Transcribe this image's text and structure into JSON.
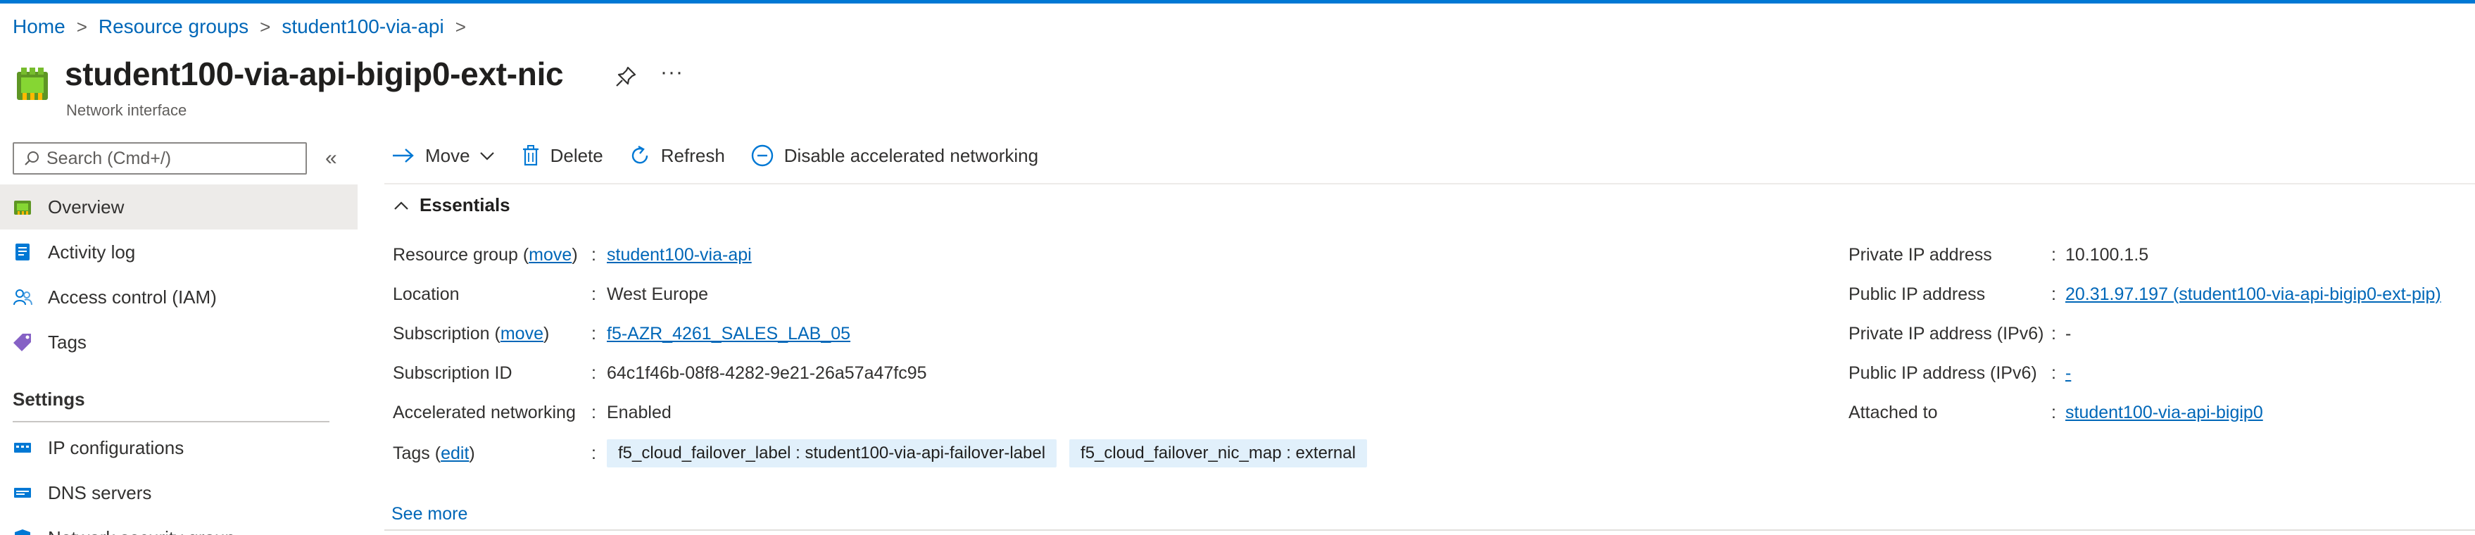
{
  "breadcrumb": [
    {
      "label": "Home"
    },
    {
      "label": "Resource groups"
    },
    {
      "label": "student100-via-api"
    }
  ],
  "header": {
    "title": "student100-via-api-bigip0-ext-nic",
    "subtitle": "Network interface",
    "pin_icon": "pin-icon",
    "more_label": "···"
  },
  "sidebar": {
    "search_placeholder": "Search (Cmd+/)",
    "collapse_label": "«",
    "items": [
      {
        "label": "Overview",
        "icon": "nic-icon",
        "active": true
      },
      {
        "label": "Activity log",
        "icon": "log-icon"
      },
      {
        "label": "Access control (IAM)",
        "icon": "people-icon"
      },
      {
        "label": "Tags",
        "icon": "tag-icon"
      }
    ],
    "section_settings": "Settings",
    "settings_items": [
      {
        "label": "IP configurations",
        "icon": "ip-config-icon"
      },
      {
        "label": "DNS servers",
        "icon": "dns-icon"
      },
      {
        "label": "Network security group",
        "icon": "nsg-icon"
      }
    ]
  },
  "toolbar": {
    "move": "Move",
    "delete": "Delete",
    "refresh": "Refresh",
    "disable_accel": "Disable accelerated networking"
  },
  "essentials": {
    "title": "Essentials",
    "resource_group_label": "Resource group",
    "move_link": "move",
    "resource_group_value": "student100-via-api",
    "location_label": "Location",
    "location_value": "West Europe",
    "subscription_label": "Subscription",
    "subscription_value": "f5-AZR_4261_SALES_LAB_05",
    "subscription_id_label": "Subscription ID",
    "subscription_id_value": "64c1f46b-08f8-4282-9e21-26a57a47fc95",
    "accel_label": "Accelerated networking",
    "accel_value": "Enabled",
    "tags_label": "Tags",
    "edit_link": "edit",
    "tags": [
      "f5_cloud_failover_label : student100-via-api-failover-label",
      "f5_cloud_failover_nic_map : external"
    ],
    "private_ip_label": "Private IP address",
    "private_ip_value": "10.100.1.5",
    "public_ip_label": "Public IP address",
    "public_ip_value": "20.31.97.197 (student100-via-api-bigip0-ext-pip)",
    "private_ipv6_label": "Private IP address (IPv6)",
    "private_ipv6_value": "-",
    "public_ipv6_label": "Public IP address (IPv6)",
    "public_ipv6_value": "-",
    "attached_label": "Attached to",
    "attached_value": "student100-via-api-bigip0",
    "see_more": "See more"
  },
  "colors": {
    "accent": "#0078d4",
    "link": "#0067b8",
    "tag_bg": "#e1f0fb"
  }
}
